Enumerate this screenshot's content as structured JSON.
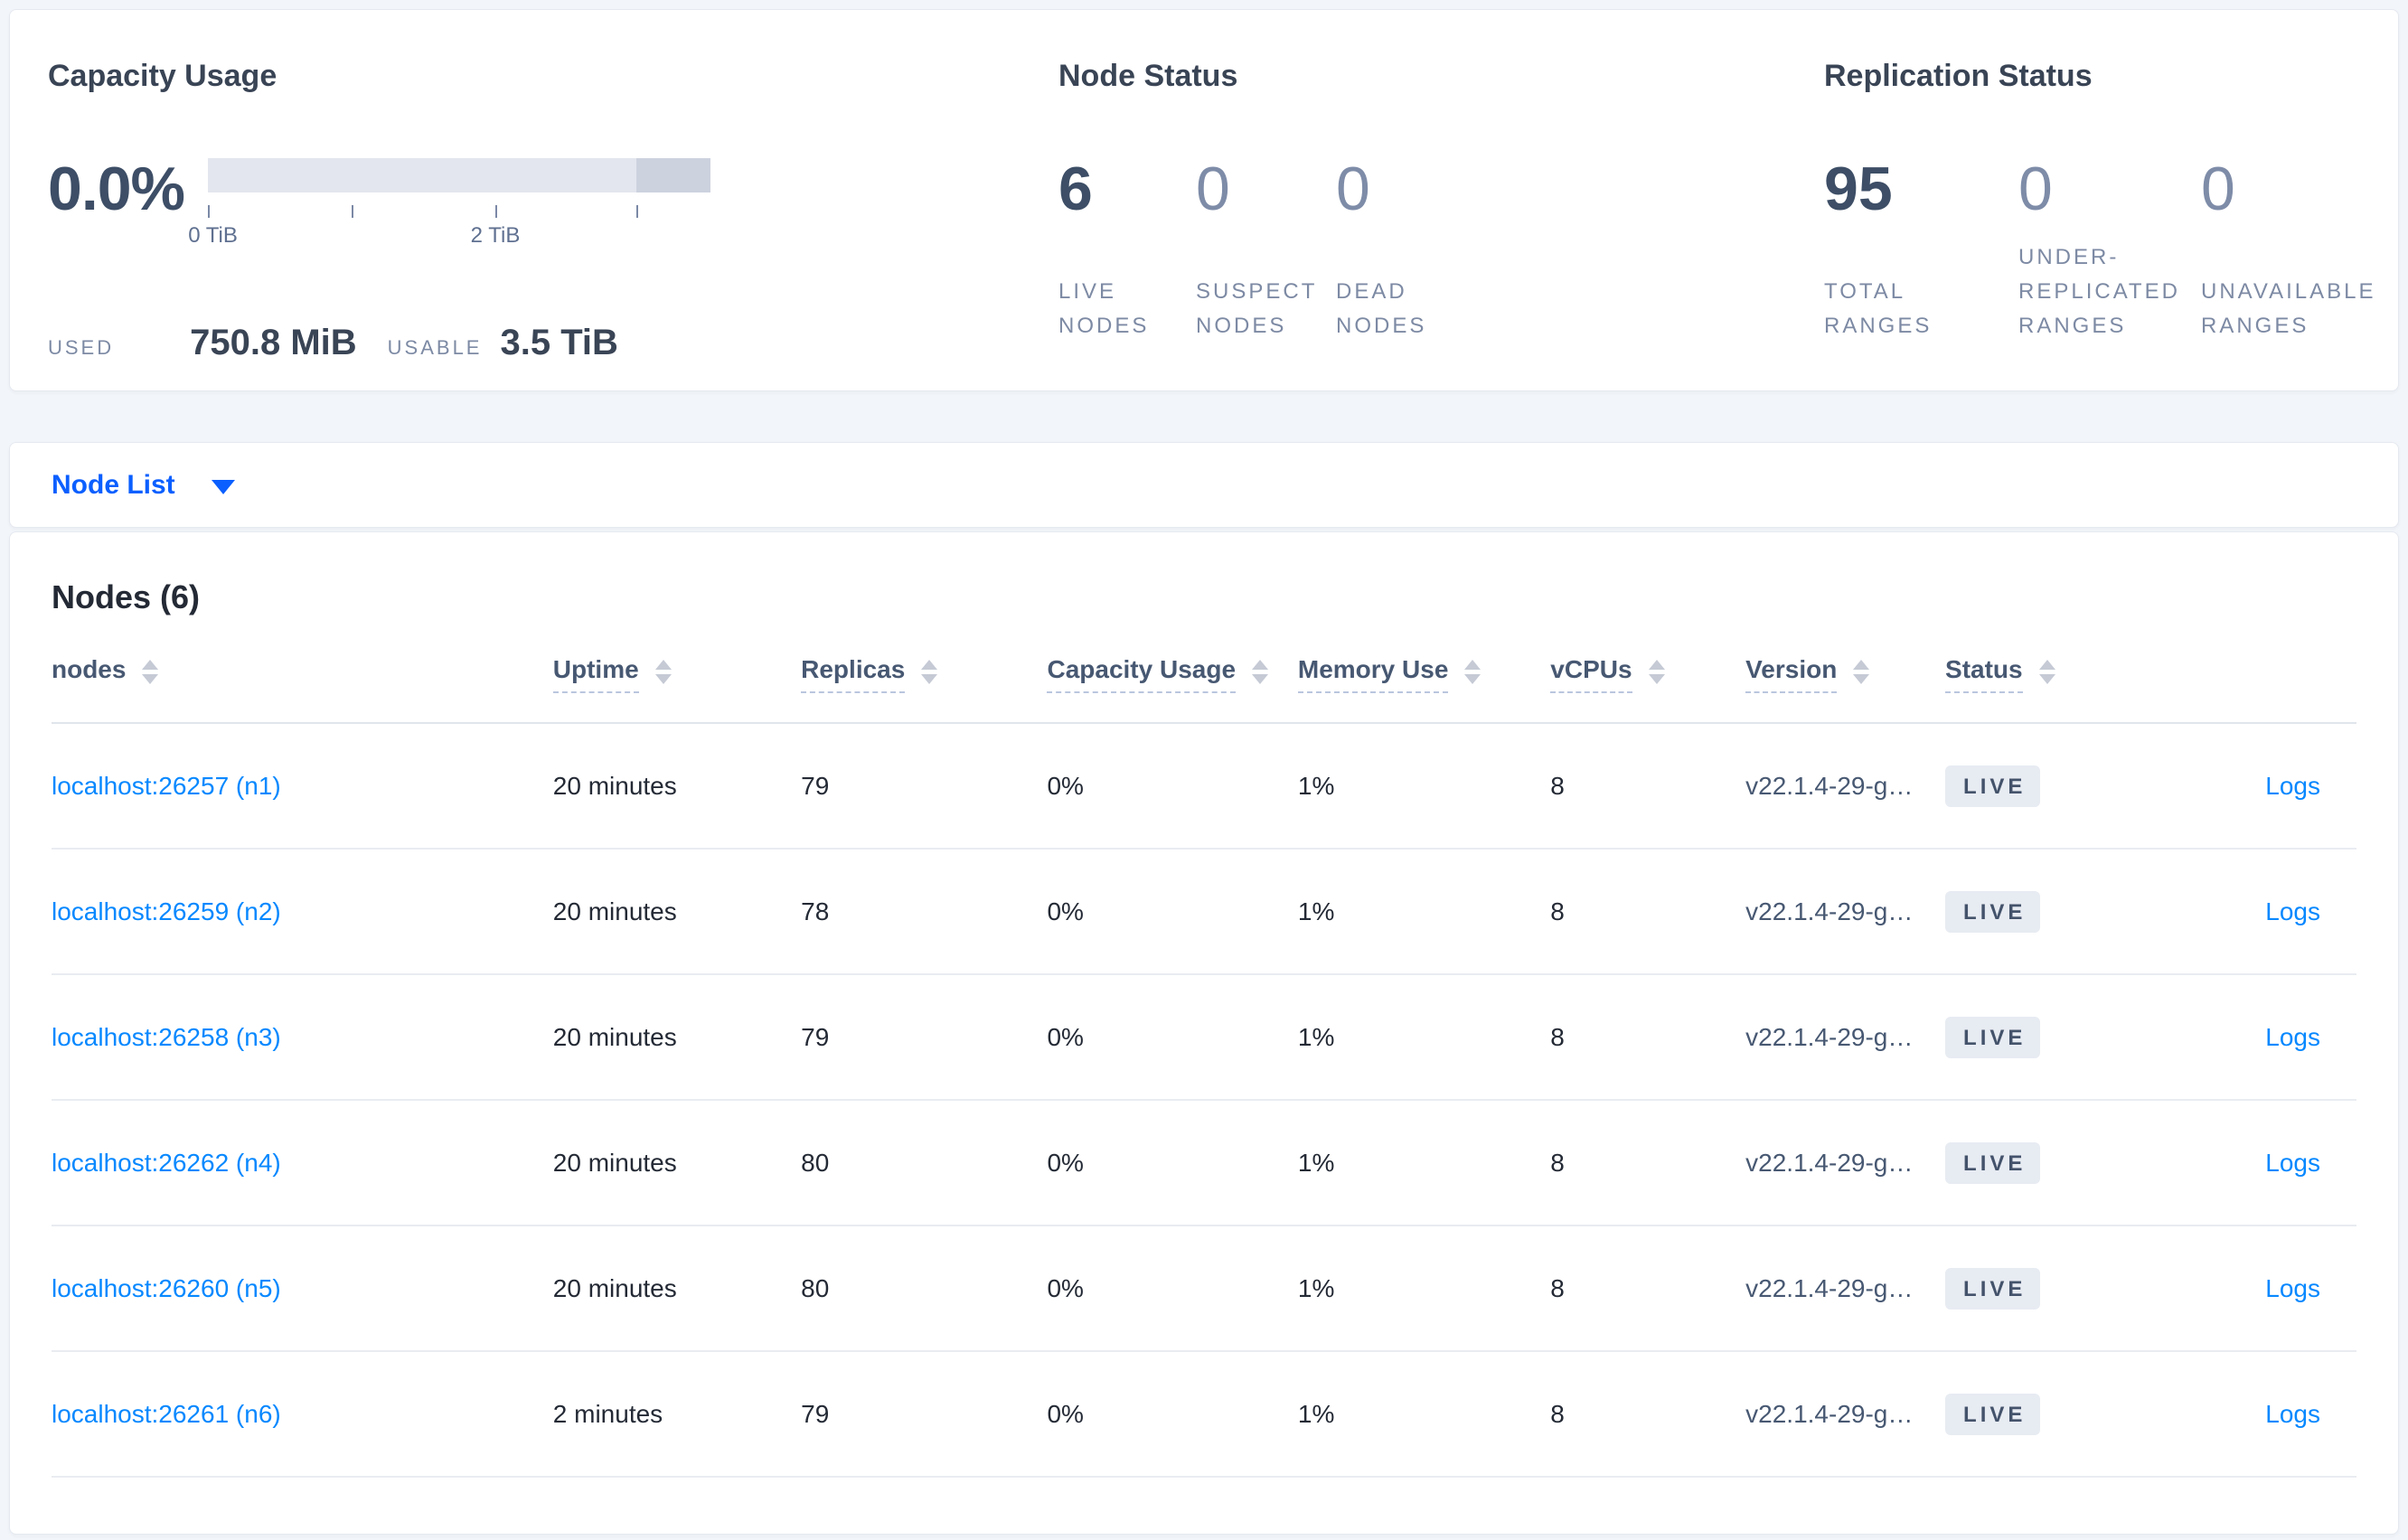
{
  "capacity": {
    "title": "Capacity Usage",
    "percent": "0.0%",
    "used_label": "USED",
    "used_value": "750.8 MiB",
    "usable_label": "USABLE",
    "usable_value": "3.5 TiB",
    "bar": {
      "used_fraction": 0.0,
      "total_tib": 3.5,
      "tick_positions_tib": [
        0,
        1,
        2,
        3
      ],
      "tick_labels": [
        {
          "text": "0 TiB",
          "at_tib": 0
        },
        {
          "text": "2 TiB",
          "at_tib": 2
        }
      ],
      "track_color": "#e3e6ee",
      "tail_color": "#cdd2df"
    }
  },
  "node_status": {
    "title": "Node Status",
    "stats": [
      {
        "value": "6",
        "label": "LIVE NODES"
      },
      {
        "value": "0",
        "label": "SUSPECT NODES"
      },
      {
        "value": "0",
        "label": "DEAD NODES"
      }
    ]
  },
  "replication_status": {
    "title": "Replication Status",
    "stats": [
      {
        "value": "95",
        "label": "TOTAL RANGES"
      },
      {
        "value": "0",
        "label": "UNDER-REPLICATED RANGES"
      },
      {
        "value": "0",
        "label": "UNAVAILABLE RANGES"
      }
    ]
  },
  "node_list": {
    "label": "Node List"
  },
  "table": {
    "title": "Nodes (6)",
    "logs_label": "Logs",
    "columns": [
      {
        "label": "nodes"
      },
      {
        "label": "Uptime"
      },
      {
        "label": "Replicas"
      },
      {
        "label": "Capacity Usage"
      },
      {
        "label": "Memory Use"
      },
      {
        "label": "vCPUs"
      },
      {
        "label": "Version"
      },
      {
        "label": "Status"
      }
    ],
    "rows": [
      {
        "node": "localhost:26257 (n1)",
        "uptime": "20 minutes",
        "replicas": "79",
        "capacity": "0%",
        "memory": "1%",
        "vcpus": "8",
        "version": "v22.1.4-29-g…",
        "status": "LIVE"
      },
      {
        "node": "localhost:26259 (n2)",
        "uptime": "20 minutes",
        "replicas": "78",
        "capacity": "0%",
        "memory": "1%",
        "vcpus": "8",
        "version": "v22.1.4-29-g…",
        "status": "LIVE"
      },
      {
        "node": "localhost:26258 (n3)",
        "uptime": "20 minutes",
        "replicas": "79",
        "capacity": "0%",
        "memory": "1%",
        "vcpus": "8",
        "version": "v22.1.4-29-g…",
        "status": "LIVE"
      },
      {
        "node": "localhost:26262 (n4)",
        "uptime": "20 minutes",
        "replicas": "80",
        "capacity": "0%",
        "memory": "1%",
        "vcpus": "8",
        "version": "v22.1.4-29-g…",
        "status": "LIVE"
      },
      {
        "node": "localhost:26260 (n5)",
        "uptime": "20 minutes",
        "replicas": "80",
        "capacity": "0%",
        "memory": "1%",
        "vcpus": "8",
        "version": "v22.1.4-29-g…",
        "status": "LIVE"
      },
      {
        "node": "localhost:26261 (n6)",
        "uptime": "2 minutes",
        "replicas": "79",
        "capacity": "0%",
        "memory": "1%",
        "vcpus": "8",
        "version": "v22.1.4-29-g…",
        "status": "LIVE"
      }
    ]
  },
  "colors": {
    "page_background": "#f2f5f9",
    "link_blue": "#0788ff",
    "dropdown_blue": "#0b5fff",
    "heading_dark": "#394455",
    "stat_muted": "#7e8ca8",
    "label_muted": "#7d8aa4",
    "badge_background": "#e7ebf2",
    "badge_text": "#44536b"
  }
}
